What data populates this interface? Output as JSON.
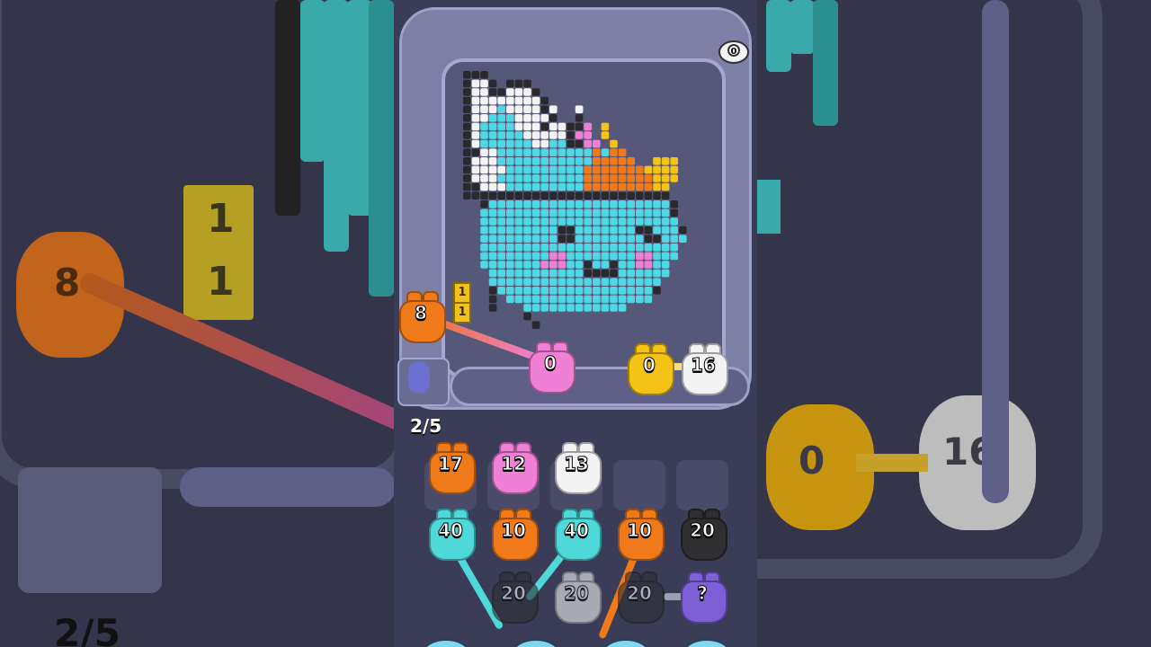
{
  "game": {
    "round_counter": "2/5",
    "track_critters": [
      {
        "id": "orange-loading",
        "value": "8",
        "color": "#f07a1a"
      },
      {
        "id": "pink",
        "value": "0",
        "color": "#f07fd6"
      },
      {
        "id": "yellow",
        "value": "0",
        "color": "#f5c216"
      },
      {
        "id": "white",
        "value": "16",
        "color": "#f3f3f3"
      }
    ],
    "pending_blocks": [
      "1",
      "1"
    ],
    "holding_slots": [
      {
        "value": "17",
        "color": "#f07a1a"
      },
      {
        "value": "12",
        "color": "#f07fd6"
      },
      {
        "value": "13",
        "color": "#f3f3f3"
      },
      {
        "value": "",
        "color": ""
      },
      {
        "value": "",
        "color": ""
      }
    ],
    "queue_row1": [
      {
        "value": "40",
        "color": "#4fd8d8"
      },
      {
        "value": "10",
        "color": "#f07a1a"
      },
      {
        "value": "40",
        "color": "#4fd8d8"
      },
      {
        "value": "10",
        "color": "#f07a1a"
      },
      {
        "value": "20",
        "color": "#2f2f32"
      }
    ],
    "queue_row2": [
      {
        "value": "20",
        "color": "#2f2f32"
      },
      {
        "value": "20",
        "color": "#f3f3f3"
      },
      {
        "value": "20",
        "color": "#2f2f32"
      },
      {
        "value": "?",
        "color": "#7d5fd8"
      }
    ],
    "background_left": {
      "pending_blocks": [
        "1",
        "1"
      ],
      "critter_value": "8",
      "counter": "2/5"
    },
    "background_right": {
      "critter_values": [
        "0",
        "16"
      ]
    }
  },
  "colors": {
    "teal": "#4fd8e4",
    "orange": "#f07a1a",
    "white": "#f3f3f3",
    "black": "#2a2a2e",
    "pink": "#f07fd6",
    "yellow": "#f5c216"
  }
}
